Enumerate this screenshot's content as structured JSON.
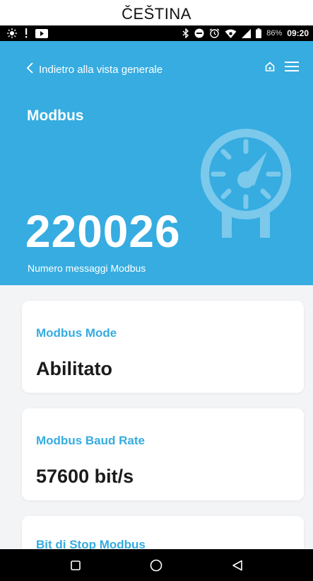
{
  "caption": "ČEŠTINA",
  "status_bar": {
    "battery": "86%",
    "time": "09:20"
  },
  "header": {
    "back_label": "Indietro alla vista generale",
    "title": "Modbus",
    "counter_value": "220026",
    "counter_label": "Numero messaggi Modbus"
  },
  "cards": [
    {
      "label": "Modbus Mode",
      "value": "Abilitato"
    },
    {
      "label": "Modbus Baud Rate",
      "value": "57600 bit/s"
    },
    {
      "label": "Bit di Stop Modbus",
      "value": ""
    }
  ],
  "colors": {
    "accent": "#36ace1",
    "background": "#f3f4f6",
    "card": "#ffffff",
    "value_text": "#1b1b1b"
  },
  "icons": {
    "status_left": [
      "brightness-icon",
      "alert-icon",
      "media-icon"
    ],
    "status_right": [
      "bluetooth-icon",
      "do-not-disturb-icon",
      "alarm-icon",
      "wifi-icon",
      "signal-icon",
      "battery-icon"
    ],
    "header": [
      "chevron-left-icon",
      "home-icon",
      "menu-icon",
      "gauge-icon"
    ],
    "nav": [
      "square-icon",
      "circle-icon",
      "triangle-back-icon"
    ]
  }
}
